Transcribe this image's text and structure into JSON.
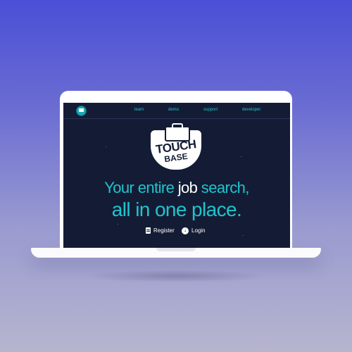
{
  "nav": {
    "links": [
      "learn",
      "demo",
      "support",
      "developer"
    ]
  },
  "brand": {
    "line1": "TOUCH",
    "line2": "BASE"
  },
  "hero": {
    "headline_part1": "Your entire ",
    "headline_highlight": "job",
    "headline_part2": " search,",
    "headline_line2": "all in one place."
  },
  "actions": {
    "register": "Register",
    "login": "Login"
  },
  "colors": {
    "background_top": "#4a4fd6",
    "background_bottom": "#b6b5cf",
    "screen_bg": "#141c35",
    "accent": "#1fc4cc"
  }
}
